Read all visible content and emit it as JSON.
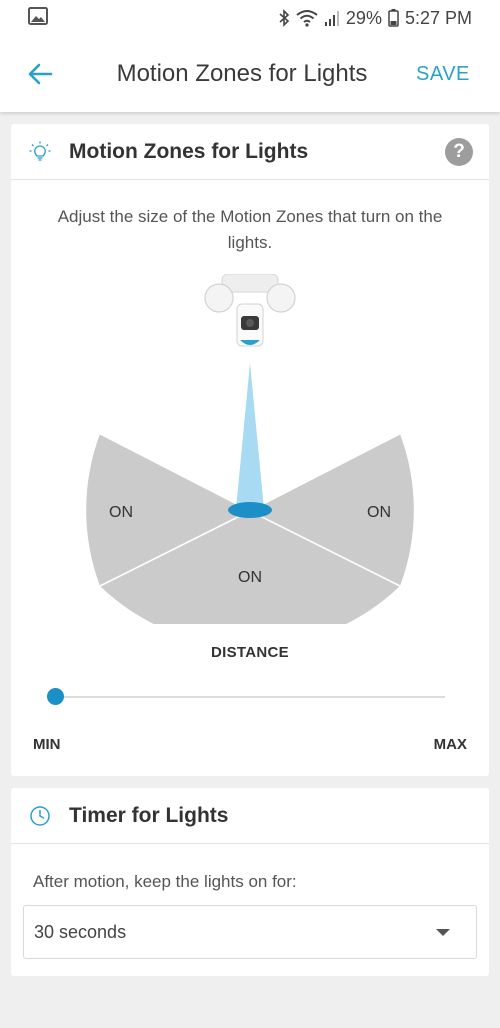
{
  "status_bar": {
    "battery": "29%",
    "time": "5:27 PM"
  },
  "app_bar": {
    "title": "Motion Zones for Lights",
    "save_label": "SAVE"
  },
  "motion_card": {
    "title": "Motion Zones for Lights",
    "help": "?",
    "description": "Adjust the size of the Motion Zones that turn on the lights.",
    "zones": {
      "left": "ON",
      "right": "ON",
      "bottom": "ON"
    },
    "distance_label": "DISTANCE",
    "min_label": "MIN",
    "max_label": "MAX",
    "slider_value": 0
  },
  "timer_card": {
    "title": "Timer for Lights",
    "description": "After motion, keep the lights on for:",
    "selected": "30 seconds"
  },
  "colors": {
    "accent": "#2aa1c8",
    "slider": "#1c8fc6",
    "zone": "#cbcbcb",
    "beam": "#a8daf3"
  },
  "icons": [
    "image-icon",
    "bluetooth-icon",
    "wifi-icon",
    "signal-icon",
    "battery-icon",
    "back-arrow-icon",
    "light-bulb-icon",
    "help-icon",
    "clock-icon",
    "chevron-down-icon"
  ]
}
